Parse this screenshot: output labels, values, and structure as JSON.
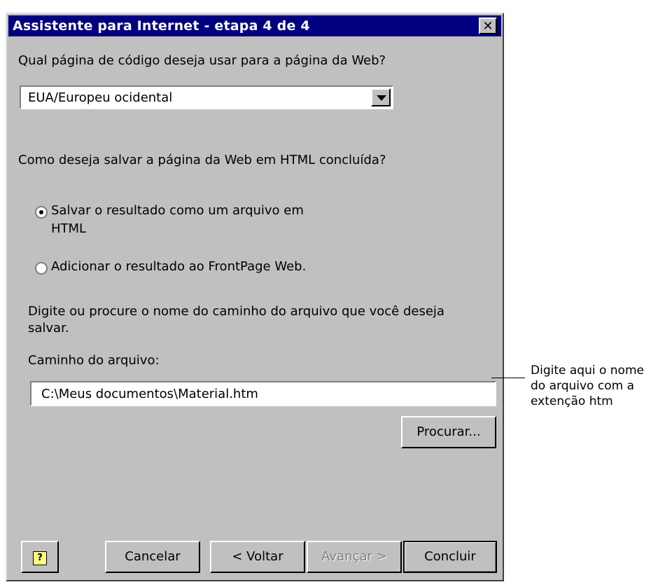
{
  "window": {
    "title": "Assistente para Internet - etapa 4 de 4",
    "close_label": "✕"
  },
  "codepage": {
    "question": "Qual página de código deseja usar para a página da Web?",
    "selected": "EUA/Europeu ocidental"
  },
  "save": {
    "question": "Como deseja salvar a página da Web em HTML concluída?",
    "options": [
      {
        "line1": "Salvar o resultado como um arquivo em",
        "line2": "HTML",
        "checked": true
      },
      {
        "line1": "Adicionar o resultado ao FrontPage Web.",
        "checked": false
      }
    ]
  },
  "path": {
    "instruction_line1": "Digite ou procure o nome do caminho do arquivo que você deseja",
    "instruction_line2": "salvar.",
    "label": "Caminho do arquivo:",
    "value": "C:\\Meus documentos\\Material.htm",
    "browse_label": "Procurar..."
  },
  "buttons": {
    "help": "?",
    "cancel": "Cancelar",
    "back": "< Voltar",
    "next": "Avançar >",
    "finish": "Concluir"
  },
  "callout": {
    "line1": "Digite aqui o nome",
    "line2": "do arquivo com a",
    "line3": "extenção htm"
  }
}
